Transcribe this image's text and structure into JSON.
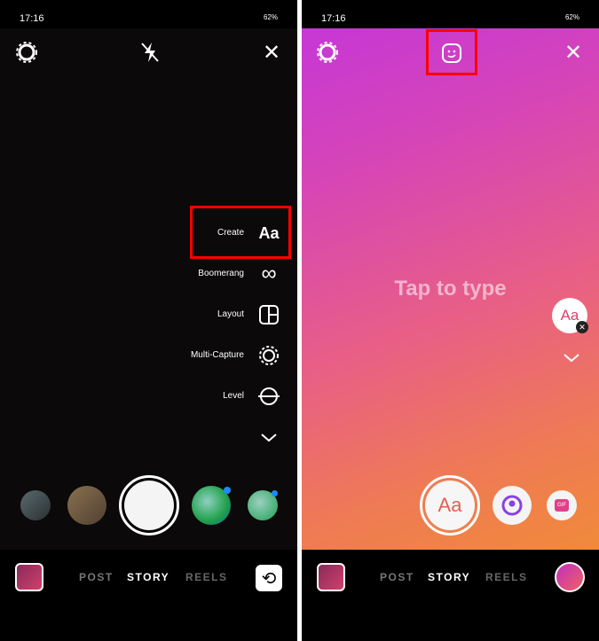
{
  "left": {
    "status": {
      "time": "17:16",
      "battery": "62%"
    },
    "top_icons": [
      "settings-icon",
      "flash-off-icon",
      "close-icon"
    ],
    "menu": [
      {
        "label": "Create",
        "icon": "Aa"
      },
      {
        "label": "Boomerang",
        "icon": "infinity-icon"
      },
      {
        "label": "Layout",
        "icon": "layout-icon"
      },
      {
        "label": "Multi-Capture",
        "icon": "multi-capture-icon"
      },
      {
        "label": "Level",
        "icon": "level-icon"
      }
    ],
    "modes": [
      "POST",
      "STORY",
      "REELS"
    ],
    "active_mode": "STORY"
  },
  "right": {
    "status": {
      "time": "17:16",
      "battery": "62%"
    },
    "top_icons": [
      "settings-icon",
      "sticker-icon",
      "close-icon"
    ],
    "placeholder": "Tap to type",
    "font_bubble": "Aa",
    "capture_label": "Aa",
    "gif_label": "GIF",
    "modes": [
      "POST",
      "STORY",
      "REELS"
    ],
    "active_mode": "STORY"
  },
  "colors": {
    "highlight": "#ff0000",
    "gradient_start": "#c637d6",
    "gradient_end": "#f08a3a"
  }
}
